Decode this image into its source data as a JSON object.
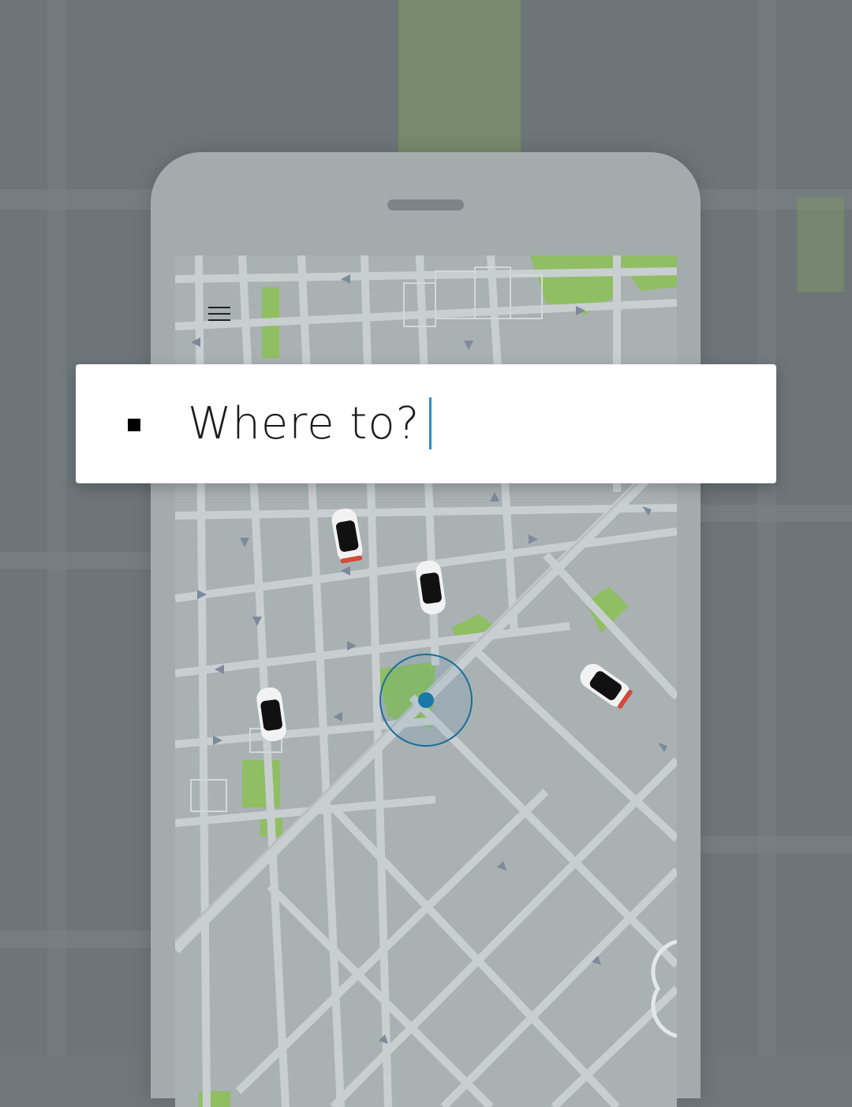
{
  "search": {
    "placeholder": "Where to?"
  },
  "icons": {
    "menu": "hamburger-menu-icon",
    "search_marker": "square-marker-icon",
    "location": "current-location-dot-icon",
    "car": "car-icon"
  },
  "colors": {
    "background": "#6f777a",
    "phone_body": "#a4abad",
    "map_base": "#a9b1b3",
    "street": "#c9cfd1",
    "park": "#8fbe63",
    "location_dot": "#1a78a8",
    "caret": "#2a8fd0",
    "card": "#ffffff"
  }
}
